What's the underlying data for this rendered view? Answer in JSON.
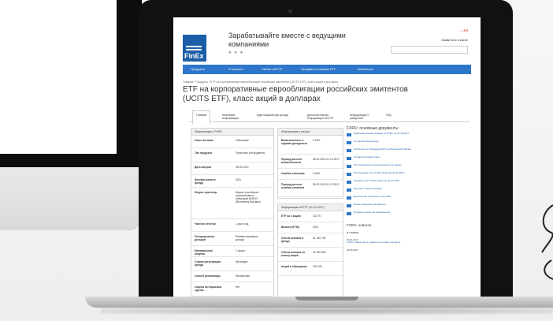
{
  "site": {
    "logo_text": "FinEx",
    "tagline": "Зарабатывайте вместе с ведущими компаниями",
    "carousel_dots": "● ● ●",
    "lang": "— EN",
    "login": "Заявиться в кассе",
    "search_placeholder": ""
  },
  "nav": [
    "Продукты",
    "О проекте",
    "Узнать об ETF",
    "Продажа и покупка ETF",
    "Аналитика"
  ],
  "breadcrumb": "Главная / Продукты / ETF на корпоративные еврооблигации российских эмитентов (UCITS ETF), класс акций в долларах",
  "page_title": "ETF на корпоративные еврооблигации российских эмитентов (UCITS ETF), класс акций в долларах",
  "tabs": [
    "Главная",
    "Ключевая информация",
    "Идентификаторы фонда",
    "Дополнительная информация об ETF",
    "Информация о раскрытии",
    "FAQ"
  ],
  "fund_info": {
    "header": "Информация о FXRU",
    "rows": [
      {
        "k": "Класс активов",
        "v": "Облигации"
      },
      {
        "k": "Тип продукта",
        "v": "Рыночные Инструменты"
      },
      {
        "k": "Дата запуска",
        "v": "08.03.2013"
      },
      {
        "k": "Базовая валюта фонда",
        "v": "USD"
      },
      {
        "k": "Индекс-ориентир",
        "v": "Индекс российских корпоративных облигаций ЕМРUS (Bloomberg Barclays)"
      },
      {
        "k": "Частота отчетов",
        "v": "1 раз в год"
      },
      {
        "k": "Распределение доходов",
        "v": "Реинвестирование дохода"
      },
      {
        "k": "Минимальная покупка",
        "v": "1 акция"
      },
      {
        "k": "Страна регистрации фонда",
        "v": "Ирландия"
      },
      {
        "k": "Способ репликации",
        "v": "Физическая"
      },
      {
        "k": "Оценка на биржевые сделки",
        "v": "Нет"
      }
    ]
  },
  "risk_info": {
    "header": "Информация о рисках",
    "rows": [
      {
        "k": "Волатильность и годовая доходность",
        "v": "0,29%"
      },
      {
        "k": "Период расчета волатильности",
        "v": "06.03.2013 01.12.2017"
      },
      {
        "k": "Ошибка слежения",
        "v": "0,49%"
      },
      {
        "k": "Период расчета ошибки слежения",
        "v": "06.03.2013 01.12.2017"
      }
    ]
  },
  "etf_info": {
    "header": "Информация об ETF (01.12.2017)",
    "rows": [
      {
        "k": "ETF на 1 акцию",
        "v": "112.75"
      },
      {
        "k": "Валюта (ETW)",
        "v": "USD"
      },
      {
        "k": "Объем активов в фонде",
        "v": "51 150 750"
      },
      {
        "k": "Объем активов по классу акций",
        "v": "46 780 850"
      },
      {
        "k": "Акций в обращении",
        "v": "351 400"
      }
    ]
  },
  "docs": {
    "title": "FXRU: основные документы",
    "items": [
      "Информационная справка по FXRU на 31.10.2017",
      "Состав активов фонда",
      "Особенности обращения ETF на Московской бирже",
      "Условия об инвестиции",
      "Об ограничении ответственности за индекс",
      "Полугодовой отчет FinEx Funds plc 31.06.2017",
      "Годовой отчет FinEx Funds plc 31.12.2016",
      "Проспект эмиссии фонда",
      "Дополнение к проспекту по FXRU",
      "Инвестиционная декларация",
      "Порядок раскрытия информации"
    ]
  },
  "news": {
    "title": "FXRU: новости",
    "sub": "и статьи",
    "items": [
      {
        "date": "20.11.2017",
        "text": "FXRU: изменения в индексе и составе портфеля"
      },
      {
        "date": "18.09.2017",
        "text": ""
      }
    ]
  }
}
